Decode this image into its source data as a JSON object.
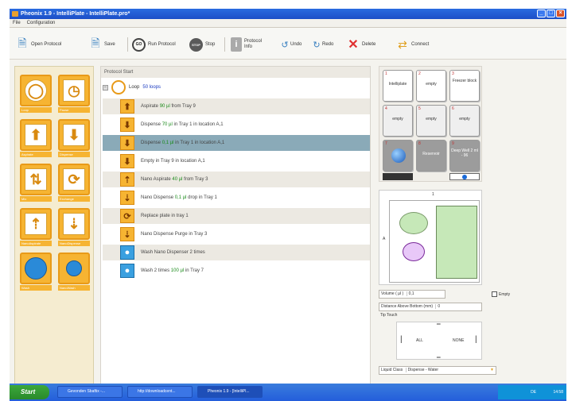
{
  "window": {
    "title": "Pheonix 1.9 - IntelliPlate - IntelliPlate.pro*"
  },
  "menu": [
    {
      "label": "File"
    },
    {
      "label": "Configuration"
    }
  ],
  "toolbar": {
    "open": "Open Protocol",
    "save": "Save",
    "run": "Run Protocol",
    "run_icon": "GO",
    "stop": "Stop",
    "stop_icon": "STOP",
    "info": "Protocol Info",
    "undo": "Undo",
    "redo": "Redo",
    "delete": "Delete",
    "connect": "Connect"
  },
  "palette": [
    {
      "label": "Loop",
      "icon": "loop-icon"
    },
    {
      "label": "Pause",
      "icon": "pause-icon"
    },
    {
      "label": "Aspirate",
      "icon": "aspirate-icon"
    },
    {
      "label": "Dispense",
      "icon": "dispense-icon"
    },
    {
      "label": "Mix",
      "icon": "mix-icon"
    },
    {
      "label": "Exchange",
      "icon": "exchange-icon"
    },
    {
      "label": "NanoAspirate",
      "icon": "nano-aspirate-icon"
    },
    {
      "label": "NanoDispense",
      "icon": "nano-dispense-icon"
    },
    {
      "label": "Wash",
      "icon": "wash-icon"
    },
    {
      "label": "NanoWash",
      "icon": "nanowash-icon"
    }
  ],
  "protocol": {
    "header": "Protocol Start",
    "loop": {
      "label": "Loop",
      "value": "50 loops"
    },
    "steps": [
      {
        "a": "Aspirate ",
        "v": "90 µl",
        "b": " from Tray 9"
      },
      {
        "a": "Dispense ",
        "v": "70 µl",
        "b": " in Tray 1 in location A,1"
      },
      {
        "a": "Dispense ",
        "v": "0,1 µl",
        "b": " in Tray 1 in location A,1"
      },
      {
        "a": "Empty in Tray 9 in location A,1",
        "v": "",
        "b": ""
      },
      {
        "a": "Nano Aspirate ",
        "v": "40 µl",
        "b": " from Tray 3"
      },
      {
        "a": "Nano Dispense ",
        "v": "0,1 µl",
        "b": " drop  in Tray 1"
      },
      {
        "a": "Replace plate in tray 1",
        "v": "",
        "b": ""
      },
      {
        "a": "Nano Dispense Purge  in Tray 3",
        "v": "",
        "b": ""
      },
      {
        "a": "Wash Nano Dispenser 2 times",
        "v": "",
        "b": ""
      },
      {
        "a": "Wash  2 times ",
        "v": "100 µl",
        "b": " in Tray 7"
      }
    ]
  },
  "deck": [
    {
      "n": "1",
      "label": "Intelliplate"
    },
    {
      "n": "2",
      "label": "empty"
    },
    {
      "n": "3",
      "label": "Freezer block"
    },
    {
      "n": "4",
      "label": "empty"
    },
    {
      "n": "5",
      "label": "empty"
    },
    {
      "n": "6",
      "label": "empty"
    },
    {
      "n": "7",
      "label": ""
    },
    {
      "n": "8",
      "label": "Reservoir"
    },
    {
      "n": "9",
      "label": "Deep Well 2 ml - 96"
    }
  ],
  "plate": {
    "col": "1",
    "row": "A"
  },
  "settings": {
    "volume_label": "Volume ( µl )",
    "volume_value": "0,1",
    "empty_label": "Empty",
    "distance_label": "Distance Above Bottom (mm)",
    "distance_value": "0",
    "tip_touch": "Tip Touch",
    "tip_all": "ALL",
    "tip_none": "NONE",
    "liquid_label": "Liquid Class",
    "liquid_value": "Dispense - Water"
  },
  "taskbar": {
    "start": "Start",
    "tasks": [
      "Gevonden Sbaftix -...",
      "http://downloadcent...",
      "Pheonix 1.9 - [IntelliPl..."
    ],
    "tray_lang": "DE",
    "tray_time": "14:58"
  },
  "colors": {
    "accent": "#f6b432",
    "selected_row": "#8aaab8",
    "titlebar": "#2a6be0"
  }
}
